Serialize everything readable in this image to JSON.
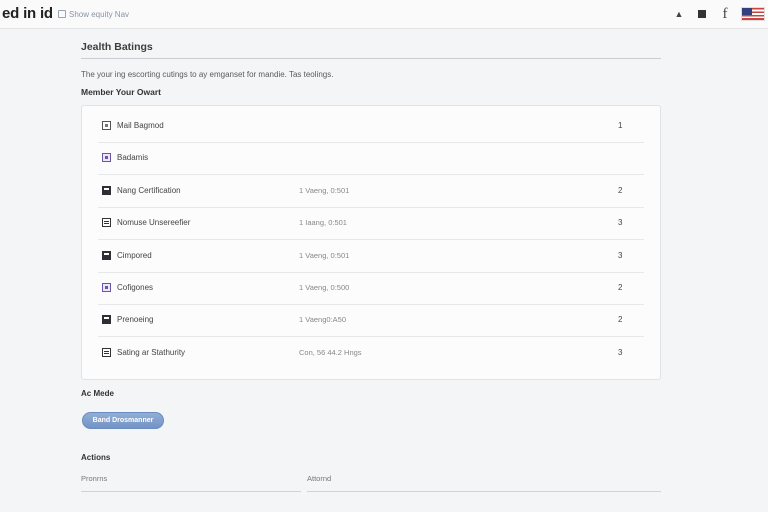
{
  "topbar": {
    "brand": "ed in id",
    "search_text": "Show equity Nav"
  },
  "page": {
    "title": "Jealth Batings",
    "intro": "The your ing escorting cutings to ay emganset for mandie. Tas teolings.",
    "subhead": "Member Your Owart"
  },
  "rows": [
    {
      "icon": "image-icon",
      "name": "Mail Bagmod",
      "date": "",
      "count": "1"
    },
    {
      "icon": "puzzle-icon",
      "name": "Badamis",
      "date": "",
      "count": ""
    },
    {
      "icon": "certificate-icon",
      "name": "Nang Certification",
      "date": "1 Vaeng, 0:501",
      "count": "2"
    },
    {
      "icon": "monitor-icon",
      "name": "Nomuse Unsereefier",
      "date": "1 Iaang, 0:501",
      "count": "3"
    },
    {
      "icon": "calendar-icon",
      "name": "Cimpored",
      "date": "1 Vaeng, 0:501",
      "count": "3"
    },
    {
      "icon": "puzzle-icon",
      "name": "Cofigones",
      "date": "1 Vaeng, 0:500",
      "count": "2"
    },
    {
      "icon": "lock-icon",
      "name": "Prenoeing",
      "date": "1 Vaeng0:A50",
      "count": "2"
    },
    {
      "icon": "list-icon",
      "name": "Sating ar Stathurity",
      "date": "Con, 56 44.2 Hngs",
      "count": "3"
    }
  ],
  "sections": {
    "ad_mode_label": "Ac Mede",
    "primary_button": "Band Drosmanner",
    "actions_label": "Actions",
    "field_left_placeholder": "Pronrns",
    "field_right_placeholder": "Attornd"
  }
}
